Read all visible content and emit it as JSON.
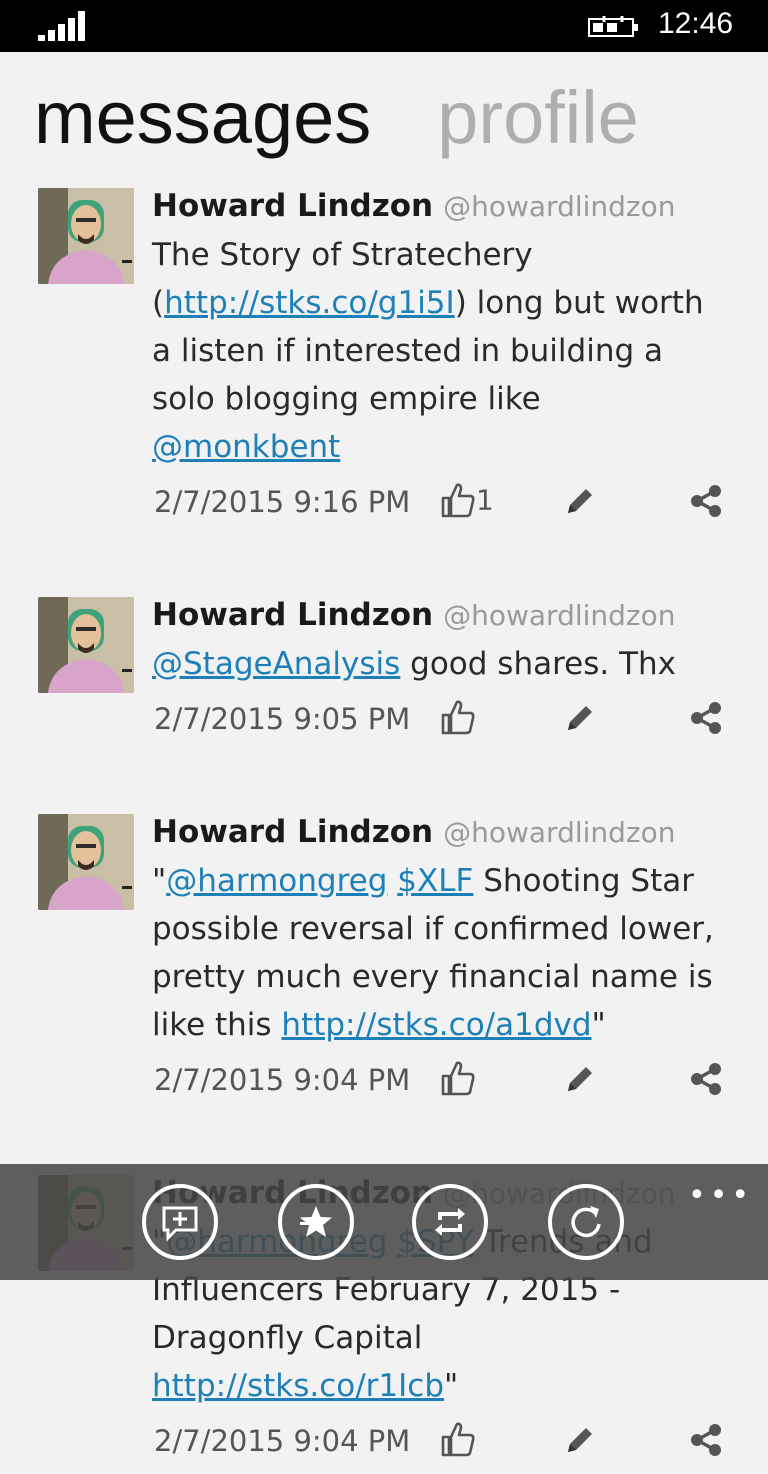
{
  "status": {
    "time": "12:46"
  },
  "pivot": {
    "active": "messages",
    "inactive": "profile"
  },
  "messages": [
    {
      "name": "Howard Lindzon",
      "handle": "@howardlindzon",
      "segments": [
        {
          "t": "The Story of Stratechery ("
        },
        {
          "t": "http://stks.co/g1i5I",
          "link": true
        },
        {
          "t": ") long but worth a listen if interested in building a solo blogging empire like "
        },
        {
          "t": "@monkbent",
          "link": true
        }
      ],
      "time": "2/7/2015 9:16 PM",
      "likes": "1"
    },
    {
      "name": "Howard Lindzon",
      "handle": "@howardlindzon",
      "segments": [
        {
          "t": "@StageAnalysis",
          "link": true
        },
        {
          "t": " good shares. Thx"
        }
      ],
      "time": "2/7/2015 9:05 PM",
      "likes": ""
    },
    {
      "name": "Howard Lindzon",
      "handle": "@howardlindzon",
      "segments": [
        {
          "t": "\""
        },
        {
          "t": "@harmongreg",
          "link": true
        },
        {
          "t": " "
        },
        {
          "t": "$XLF",
          "link": true
        },
        {
          "t": " Shooting Star possible reversal if confirmed lower, pretty much every financial name is like this "
        },
        {
          "t": "http://stks.co/a1dvd",
          "link": true
        },
        {
          "t": "\""
        }
      ],
      "time": "2/7/2015 9:04 PM",
      "likes": ""
    },
    {
      "name": "Howard Lindzon",
      "handle": "@howardlindzon",
      "segments": [
        {
          "t": "\""
        },
        {
          "t": "@harmongreg",
          "link": true
        },
        {
          "t": " "
        },
        {
          "t": "$SPY",
          "link": true
        },
        {
          "t": " Trends and Influencers February 7, 2015 - Dragonfly Capital "
        },
        {
          "t": "http://stks.co/r1Icb",
          "link": true
        },
        {
          "t": "\""
        }
      ],
      "time": "2/7/2015 9:04 PM",
      "likes": ""
    }
  ],
  "appbar": {
    "buttons": [
      "compose-icon",
      "favorite-icon",
      "retweet-icon",
      "refresh-icon"
    ],
    "more": "•••"
  }
}
